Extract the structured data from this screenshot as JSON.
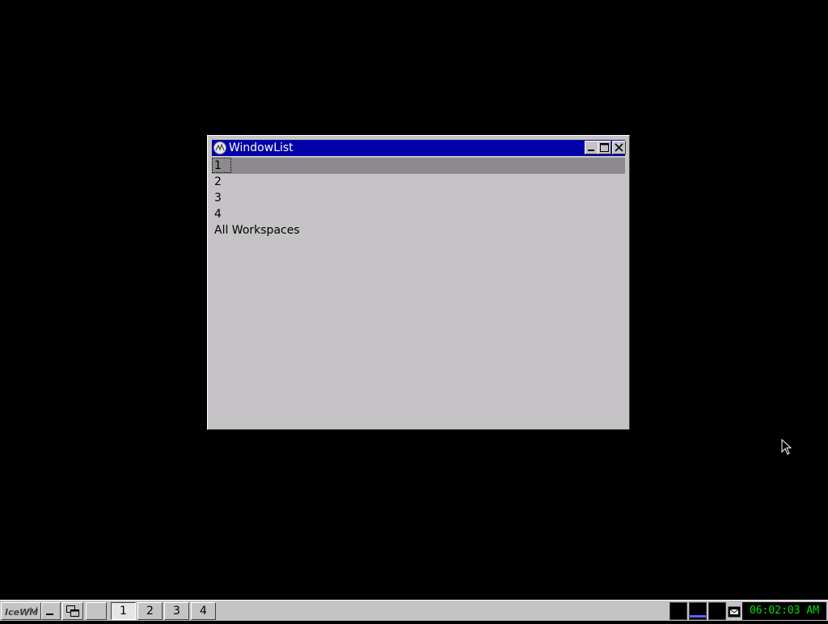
{
  "window": {
    "title": "WindowList",
    "items": [
      "1",
      "2",
      "3",
      "4",
      "All Workspaces"
    ],
    "selected_index": 0
  },
  "taskbar": {
    "start_label": "IceWM",
    "workspaces": [
      "1",
      "2",
      "3",
      "4"
    ],
    "active_workspace": "1",
    "clock": "06:02:03 AM"
  },
  "colors": {
    "titlebar": "#0000a8",
    "window_bg": "#c6c3c6",
    "clock_text": "#00e000"
  }
}
